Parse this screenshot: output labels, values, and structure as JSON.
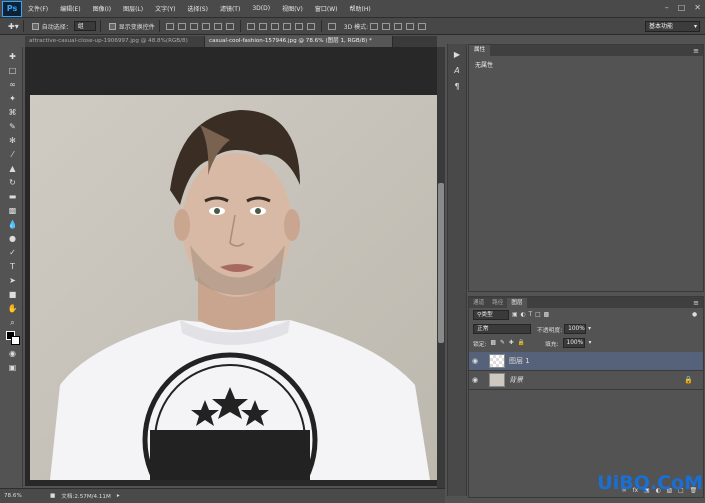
{
  "app": {
    "logo": "Ps"
  },
  "menu": [
    "文件(F)",
    "编辑(E)",
    "图像(I)",
    "图层(L)",
    "文字(Y)",
    "选择(S)",
    "滤镜(T)",
    "3D(D)",
    "视图(V)",
    "窗口(W)",
    "帮助(H)"
  ],
  "options": {
    "auto_select_label": "自动选择：",
    "auto_select_value": "组",
    "transform_label": "显示变换控件",
    "mode_3d": "3D 模式:",
    "workspace": "基本功能"
  },
  "tabs": [
    {
      "label": "attractive-casual-close-up-1906997.jpg @ 48.8%(RGB/8)"
    },
    {
      "label": "casual-cool-fashion-157946.jpg @ 78.6% (图层 1, RGB/8) *"
    }
  ],
  "status": {
    "zoom": "78.6%",
    "doc": "文档:2.57M/4.11M"
  },
  "properties": {
    "tab": "属性",
    "text": "无属性"
  },
  "layers": {
    "tabs": [
      "通道",
      "路径",
      "图层"
    ],
    "filter_label": "类型",
    "blend_mode": "正常",
    "opacity_label": "不透明度:",
    "opacity_value": "100%",
    "lock_label": "锁定:",
    "fill_label": "填充:",
    "fill_value": "100%",
    "items": [
      {
        "name": "图层 1"
      },
      {
        "name": "背景"
      }
    ]
  },
  "watermark": {
    "text": "UiBQ.CoM"
  },
  "colors": {
    "accent": "#31a8ff",
    "selected_layer": "#56627a"
  }
}
